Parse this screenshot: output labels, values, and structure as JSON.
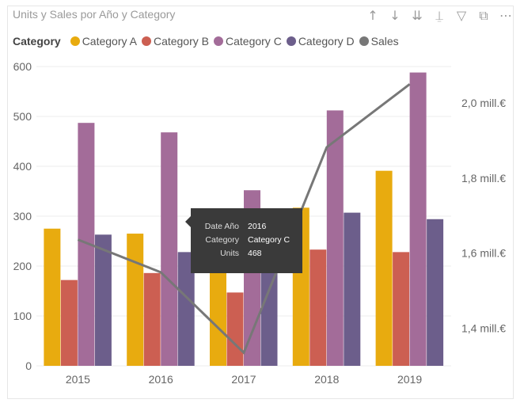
{
  "header": {
    "title": "Units y Sales por Año y Category",
    "icons": [
      "arrow-up-icon",
      "arrow-down-icon",
      "double-arrow-down-icon",
      "expand-hierarchy-icon",
      "filter-icon",
      "focus-mode-icon",
      "more-options-icon"
    ]
  },
  "chart_data": {
    "type": "bar",
    "title": "Units y Sales por Año y Category",
    "legend_title": "Category",
    "legend_position": "top-left",
    "categories": [
      "2015",
      "2016",
      "2017",
      "2018",
      "2019"
    ],
    "series": [
      {
        "name": "Category A",
        "color": "#E8AB0F",
        "values": [
          275,
          265,
          200,
          317,
          391
        ]
      },
      {
        "name": "Category B",
        "color": "#CC5F52",
        "values": [
          172,
          186,
          147,
          233,
          228
        ]
      },
      {
        "name": "Category C",
        "color": "#A36C99",
        "values": [
          487,
          468,
          352,
          512,
          588
        ]
      },
      {
        "name": "Category D",
        "color": "#6C5E8B",
        "values": [
          263,
          228,
          215,
          307,
          294
        ]
      }
    ],
    "line_series": {
      "name": "Sales",
      "color": "#777777",
      "axis": "right",
      "values": [
        1636000,
        1549000,
        1335000,
        1882000,
        2050000
      ]
    },
    "y_left": {
      "range": [
        0,
        600
      ],
      "ticks": [
        "0",
        "100",
        "200",
        "300",
        "400",
        "500",
        "600"
      ]
    },
    "y_right": {
      "range": [
        1300000,
        2097000
      ],
      "ticks": [
        {
          "v": 1400000,
          "label": "1,4 mill.€"
        },
        {
          "v": 1600000,
          "label": "1,6 mill.€"
        },
        {
          "v": 1800000,
          "label": "1,8 mill.€"
        },
        {
          "v": 2000000,
          "label": "2,0 mill.€"
        }
      ]
    },
    "grid": true
  },
  "tooltip": {
    "rows": [
      {
        "k": "Date Año",
        "v": "2016"
      },
      {
        "k": "Category",
        "v": "Category C"
      },
      {
        "k": "Units",
        "v": "468"
      }
    ]
  }
}
